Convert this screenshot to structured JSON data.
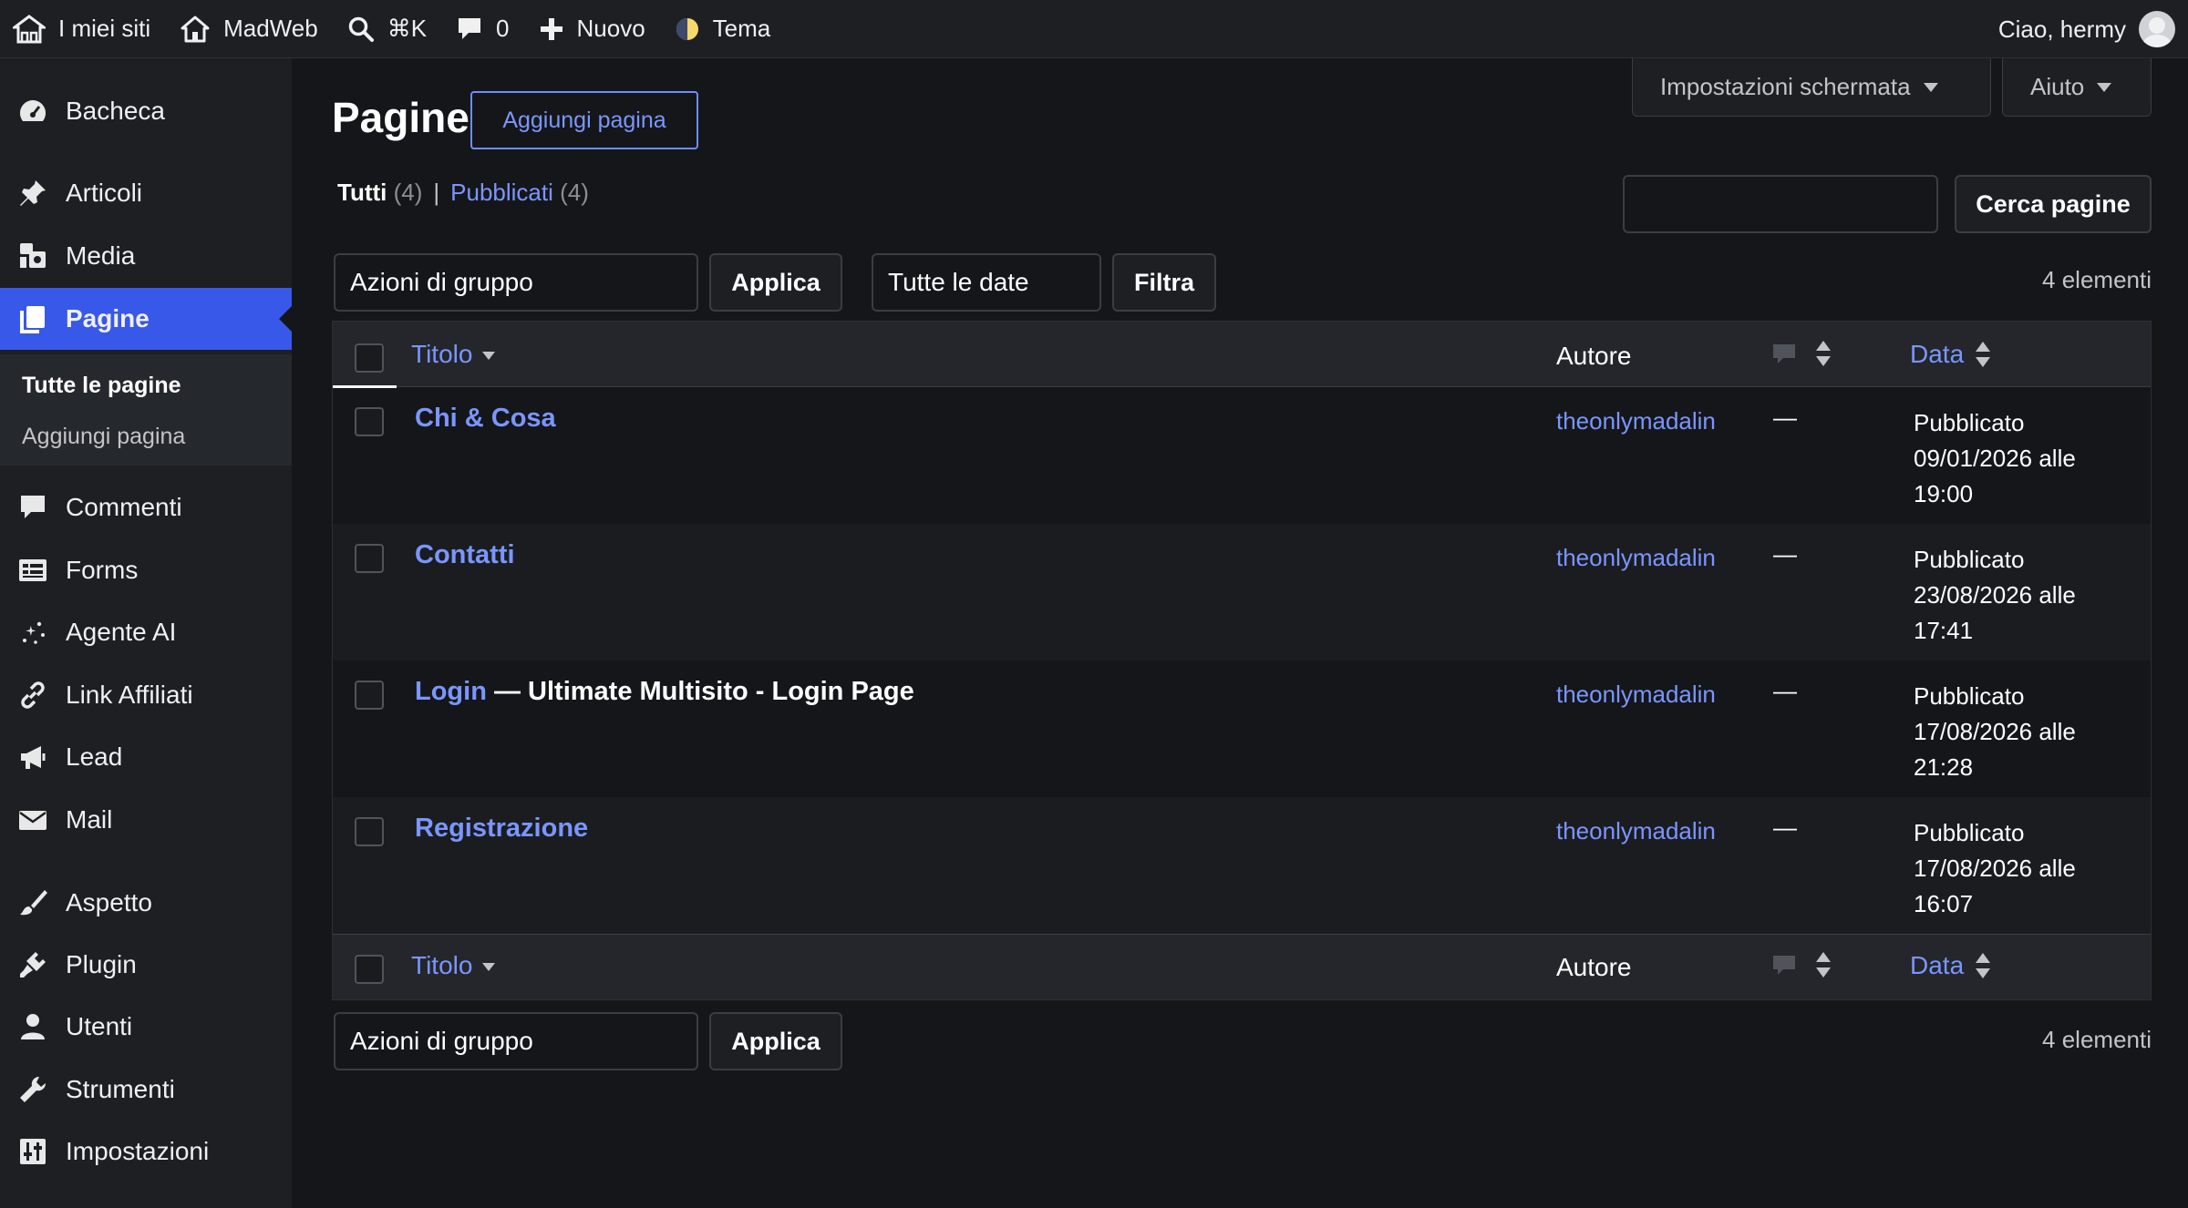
{
  "adminbar": {
    "my_sites": "I miei siti",
    "site_name": "MadWeb",
    "command_shortcut": "⌘K",
    "comments_count": "0",
    "new_label": "Nuovo",
    "theme_label": "Tema",
    "greeting": "Ciao, hermy"
  },
  "sidebar": {
    "items": [
      {
        "label": "Bacheca",
        "icon": "dashboard-icon"
      },
      {
        "label": "Articoli",
        "icon": "pin-icon"
      },
      {
        "label": "Media",
        "icon": "media-icon"
      },
      {
        "label": "Pagine",
        "icon": "pages-icon",
        "active": true
      },
      {
        "label": "Commenti",
        "icon": "comment-icon"
      },
      {
        "label": "Forms",
        "icon": "forms-icon"
      },
      {
        "label": "Agente AI",
        "icon": "sparkle-icon"
      },
      {
        "label": "Link Affiliati",
        "icon": "link-icon"
      },
      {
        "label": "Lead",
        "icon": "megaphone-icon"
      },
      {
        "label": "Mail",
        "icon": "mail-icon"
      },
      {
        "label": "Aspetto",
        "icon": "brush-icon"
      },
      {
        "label": "Plugin",
        "icon": "plugin-icon"
      },
      {
        "label": "Utenti",
        "icon": "user-icon"
      },
      {
        "label": "Strumenti",
        "icon": "wrench-icon"
      },
      {
        "label": "Impostazioni",
        "icon": "settings-icon"
      }
    ],
    "submenu": [
      "Tutte le pagine",
      "Aggiungi pagina"
    ]
  },
  "page": {
    "title": "Pagine",
    "add_button": "Aggiungi pagina",
    "screen_options": "Impostazioni schermata",
    "help": "Aiuto",
    "filters": {
      "all_label": "Tutti",
      "all_count": "(4)",
      "separator": "|",
      "published_label": "Pubblicati",
      "published_count": "(4)"
    },
    "search_value": "",
    "search_button": "Cerca pagine",
    "bulk_actions": "Azioni di gruppo",
    "apply": "Applica",
    "date_filter": "Tutte le date",
    "filter_button": "Filtra",
    "items_count": "4 elementi"
  },
  "table": {
    "columns": {
      "title": "Titolo",
      "author": "Autore",
      "date": "Data"
    },
    "rows": [
      {
        "title": "Chi & Cosa",
        "state": "",
        "author": "theonlymadalin",
        "comments": "—",
        "date_status": "Pubblicato",
        "date_line": "09/01/2026 alle",
        "time": "19:00"
      },
      {
        "title": "Contatti",
        "state": "",
        "author": "theonlymadalin",
        "comments": "—",
        "date_status": "Pubblicato",
        "date_line": "23/08/2026 alle",
        "time": "17:41"
      },
      {
        "title": "Login",
        "state": " — Ultimate Multisito - Login Page",
        "author": "theonlymadalin",
        "comments": "—",
        "date_status": "Pubblicato",
        "date_line": "17/08/2026 alle",
        "time": "21:28"
      },
      {
        "title": "Registrazione",
        "state": "",
        "author": "theonlymadalin",
        "comments": "—",
        "date_status": "Pubblicato",
        "date_line": "17/08/2026 alle",
        "time": "16:07"
      }
    ]
  },
  "colors": {
    "accent": "#3858e9",
    "link": "#7a96ff",
    "background": "#151619",
    "sidebar": "#1d1f23"
  }
}
